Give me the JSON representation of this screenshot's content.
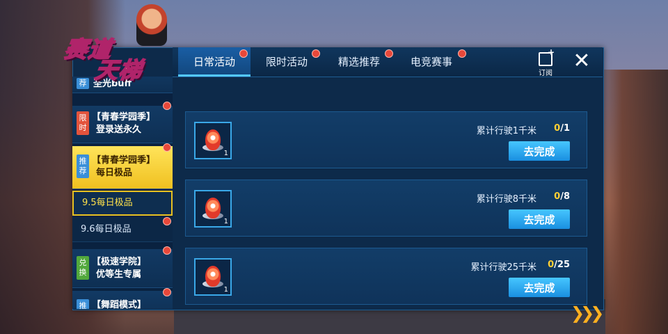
{
  "logo": {
    "line1": "赛道",
    "line2": "天梯"
  },
  "tabs": [
    {
      "label": "日常活动",
      "active": true,
      "has_dot": true
    },
    {
      "label": "限时活动",
      "active": false,
      "has_dot": true
    },
    {
      "label": "精选推荐",
      "active": false,
      "has_dot": true
    },
    {
      "label": "电竞赛事",
      "active": false,
      "has_dot": true
    }
  ],
  "header": {
    "subscribe_label": "订阅",
    "close_symbol": "✕"
  },
  "sidebar": {
    "items": [
      {
        "tag": "荐",
        "tag_color": "blue",
        "line1": "圣光buff",
        "line2": ""
      },
      {
        "tag": "限时",
        "tag_color": "red",
        "line1": "【青春学园季】",
        "line2": "登录送永久"
      },
      {
        "tag": "推荐",
        "tag_color": "blue",
        "line1": "【青春学园季】",
        "line2": "每日极品"
      },
      {
        "tag": "兑换",
        "tag_color": "green",
        "line1": "【极速学院】",
        "line2": "优等生专属"
      },
      {
        "tag": "推",
        "tag_color": "blue",
        "line1": "【舞蹈模式】",
        "line2": ""
      }
    ],
    "sub_items": [
      {
        "label": "9.5每日极品",
        "selected": true
      },
      {
        "label": "9.6每日极品",
        "selected": false
      }
    ]
  },
  "tasks": [
    {
      "description": "累计行驶1千米",
      "progress_current": "0",
      "progress_total": "/1",
      "reward_count": "1",
      "button_label": "去完成"
    },
    {
      "description": "累计行驶8千米",
      "progress_current": "0",
      "progress_total": "/8",
      "reward_count": "1",
      "button_label": "去完成"
    },
    {
      "description": "累计行驶25千米",
      "progress_current": "0",
      "progress_total": "/25",
      "reward_count": "1",
      "button_label": "去完成"
    }
  ],
  "colors": {
    "accent": "#54c8ff",
    "progress_current": "#ffcf33",
    "notify_dot": "#e8483a",
    "selected": "#f0c020"
  }
}
